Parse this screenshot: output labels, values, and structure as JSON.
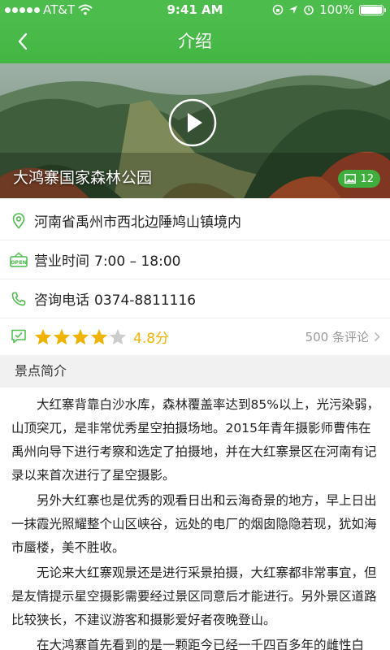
{
  "status": {
    "carrier": "AT&T",
    "time": "9:41 AM",
    "battery": "100%"
  },
  "nav": {
    "title": "介绍"
  },
  "hero": {
    "name": "大鸿寨国家森林公园",
    "photo_count": "12"
  },
  "info": {
    "address": "河南省禹州市西北边陲鸠山镇境内",
    "hours_label": "营业时间",
    "hours": "7:00 – 18:00",
    "phone_label": "咨询电话",
    "phone": "0374-8811116"
  },
  "rating": {
    "stars": 4,
    "score": "4.8分",
    "reviews": "500 条评论"
  },
  "section": {
    "title": "景点简介"
  },
  "intro": [
    "大红寨背靠白沙水库，森林覆盖率达到85%以上，光污染弱，山顶突兀，是非常优秀星空拍摄场地。2015年青年摄影师曹伟在禹州向导下进行考察和选定了拍摄地，并在大红寨景区在河南有记录以来首次进行了星空摄影。",
    "另外大红寨也是优秀的观看日出和云海奇景的地方，早上日出一抹霞光照耀整个山区峡谷，远处的电厂的烟囱隐隐若现，犹如海市蜃楼，美不胜收。",
    "无论来大红寨观景还是进行采景拍摄，大红寨都非常事宜，但是友情提示星空摄影需要经过景区同意后才能进行。另外景区道路比较狭长，不建议游客和摄影爱好者夜晚登山。",
    "在大鸿寨首先看到的是一颗距今已经一千四百多年的雌性白"
  ],
  "colors": {
    "brand_green": "#4cbd4c",
    "star": "#f0b400",
    "muted": "#999999"
  }
}
